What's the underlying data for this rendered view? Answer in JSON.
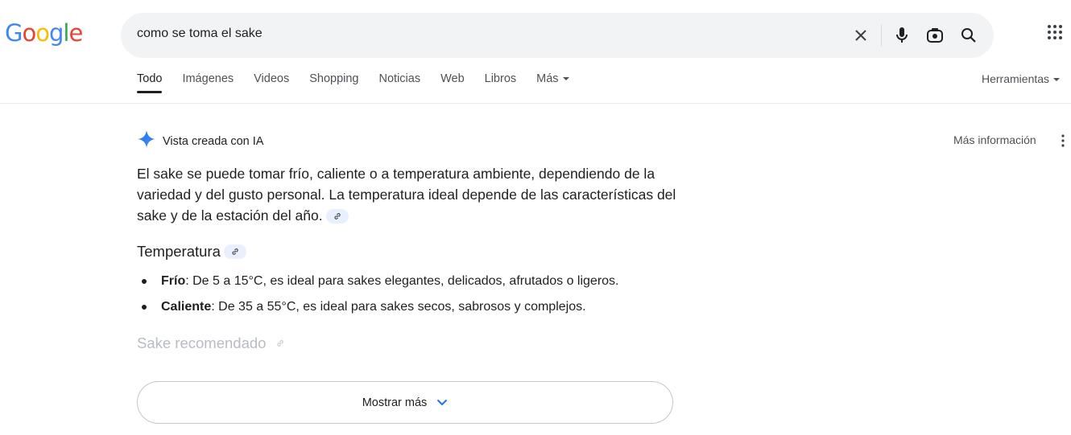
{
  "header": {
    "logo": [
      "G",
      "o",
      "o",
      "g",
      "l",
      "e"
    ],
    "logo_colors": [
      "#4285F4",
      "#EA4335",
      "#FBBC05",
      "#4285F4",
      "#34A853",
      "#EA4335"
    ],
    "search_query": "como se toma el sake",
    "icons": [
      "close-icon",
      "microphone-icon",
      "lens-camera-icon",
      "search-icon",
      "apps-grid-icon"
    ]
  },
  "tabs": [
    {
      "label": "Todo",
      "active": true
    },
    {
      "label": "Imágenes"
    },
    {
      "label": "Videos"
    },
    {
      "label": "Shopping"
    },
    {
      "label": "Noticias"
    },
    {
      "label": "Web"
    },
    {
      "label": "Libros"
    },
    {
      "label": "Más"
    }
  ],
  "tools_label": "Herramientas",
  "ai_overview": {
    "title": "Vista creada con IA",
    "more_info": "Más información",
    "summary": "El sake se puede tomar frío, caliente o a temperatura ambiente, dependiendo de la variedad y del gusto personal. La temperatura ideal depende de las características del sake y de la estación del año.",
    "section_title": "Temperatura",
    "bullets": [
      {
        "term": "Frío",
        "text": ": De 5 a 15°C, es ideal para sakes elegantes, delicados, afrutados o ligeros."
      },
      {
        "term": "Caliente",
        "text": ": De 35 a 55°C, es ideal para sakes secos, sabrosos y complejos."
      }
    ],
    "faded_section_title": "Sake recomendado",
    "show_more": "Mostrar más"
  },
  "colors": {
    "accent_blue": "#1a73e8",
    "text_primary": "#1f1f1f",
    "text_secondary": "#4d5156"
  }
}
